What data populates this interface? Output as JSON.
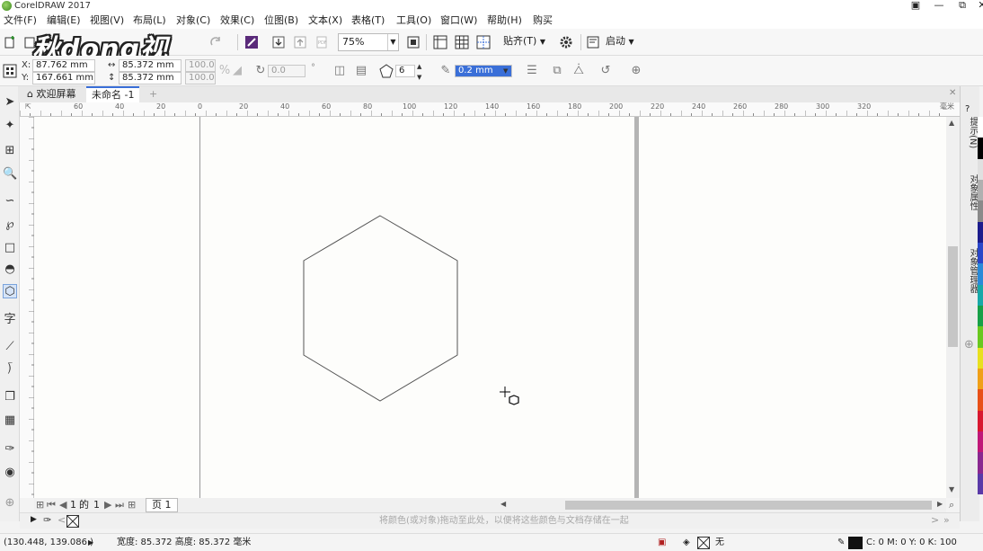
{
  "window": {
    "title": "CorelDRAW 2017"
  },
  "menu": [
    "文件(F)",
    "编辑(E)",
    "视图(V)",
    "布局(L)",
    "对象(C)",
    "效果(C)",
    "位图(B)",
    "文本(X)",
    "表格(T)",
    "工具(O)",
    "窗口(W)",
    "帮助(H)",
    "购买"
  ],
  "watermark": "秋dong视频",
  "toolbar": {
    "zoom": "75%",
    "snap": "贴齐(T)",
    "launch": "启动"
  },
  "property_bar": {
    "x": "87.762 mm",
    "y": "167.661 mm",
    "width": "85.372 mm",
    "height": "85.372 mm",
    "scale_x": "100.0",
    "scale_y": "100.0",
    "rotation": "0.0",
    "sides": "6",
    "outline_width": "0.2 mm"
  },
  "tabs": {
    "welcome": "欢迎屏幕",
    "document": "未命名 -1",
    "add": "+"
  },
  "ruler_ticks": [
    "60",
    "40",
    "20",
    "0",
    "20",
    "40",
    "60",
    "80",
    "100",
    "120",
    "140",
    "160",
    "180",
    "200",
    "220",
    "240",
    "260",
    "280",
    "300",
    "320",
    "毫米"
  ],
  "page_nav": {
    "current": "1",
    "of": "的",
    "total": "1",
    "page_tab": "页 1"
  },
  "palette_hint": "将颜色(或对象)拖动至此处，以便将这些颜色与文档存储在一起",
  "dock_tabs": [
    "提示(N)",
    "对象属性",
    "对象管理器"
  ],
  "status": {
    "coords": "(130.448, 139.086 )",
    "size": "宽度: 85.372  高度: 85.372  毫米",
    "fill": "无",
    "outline": "C: 0 M: 0 Y: 0 K: 100"
  },
  "colors": {
    "accent": "#3a6fd8",
    "palette": [
      "#ffffff",
      "#000000",
      "#e0e0e0",
      "#b0b0b0",
      "#8a8a8a",
      "#1c1c8c",
      "#2a46c8",
      "#2a8ad8",
      "#18a8a8",
      "#18a048",
      "#6ac820",
      "#e8e020",
      "#f0a018",
      "#e85018",
      "#d81830",
      "#c01878",
      "#8a2890",
      "#5a3aa8"
    ]
  }
}
